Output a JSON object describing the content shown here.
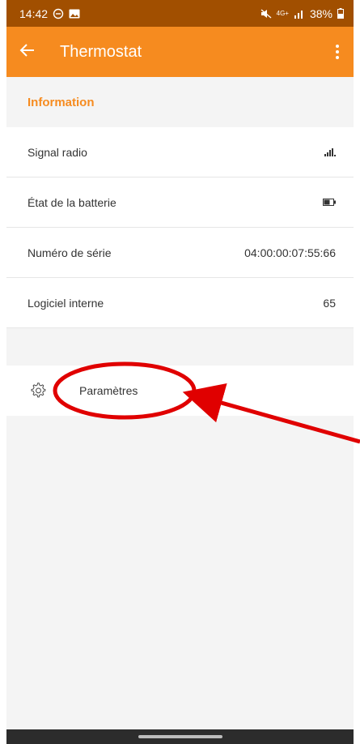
{
  "status_bar": {
    "time": "14:42",
    "network": "4G+",
    "battery": "38%"
  },
  "app_bar": {
    "title": "Thermostat"
  },
  "information": {
    "header": "Information",
    "rows": [
      {
        "label": "Signal radio",
        "value": ""
      },
      {
        "label": "État de la batterie",
        "value": ""
      },
      {
        "label": "Numéro de série",
        "value": "04:00:00:07:55:66"
      },
      {
        "label": "Logiciel interne",
        "value": "65"
      }
    ]
  },
  "settings": {
    "label": "Paramètres"
  },
  "colors": {
    "accent": "#f68b1f",
    "status_bar": "#a14f00",
    "annotation": "#e00000"
  }
}
